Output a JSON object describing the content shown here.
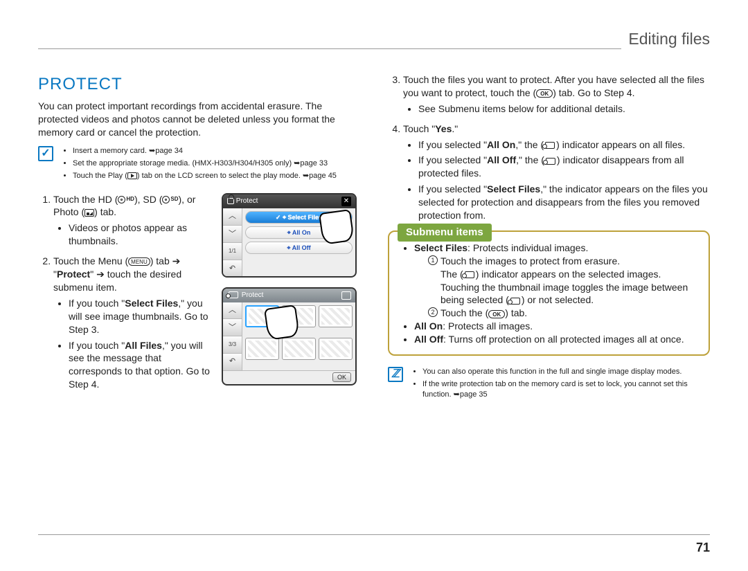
{
  "header": {
    "title": "Editing files"
  },
  "page_number": "71",
  "section": {
    "title": "PROTECT",
    "intro": "You can protect important recordings from accidental erasure. The protected videos and photos cannot be deleted unless you format the memory card or cancel the protection."
  },
  "pre_notes": [
    "Insert a memory card. ➥page 34",
    "Set the appropriate storage media. (HMX-H303/H304/H305 only) ➥page 33",
    "Touch the Play ( ▸ ) tab on the LCD screen to select the play mode. ➥page 45"
  ],
  "steps_left": {
    "s1": {
      "text_a": "Touch the HD (",
      "text_b": "), SD (",
      "text_c": "), or Photo (",
      "text_d": ") tab.",
      "bullet": "Videos or photos appear as thumbnails."
    },
    "s2": {
      "text_a": "Touch the Menu (",
      "text_b": ") tab ",
      "arrow1": "➔",
      "text_c": " \"",
      "protect": "Protect",
      "text_d": "\" ",
      "arrow2": "➔",
      "text_e": " touch the desired submenu item.",
      "b1_a": "If you touch \"",
      "b1_bold": "Select Files",
      "b1_b": ",\" you will see image thumbnails. Go to Step 3.",
      "b2_a": "If you touch \"",
      "b2_bold": "All Files",
      "b2_b": ",\" you will see the message that corresponds to that option. Go to Step 4."
    }
  },
  "steps_right": {
    "s3": {
      "text_a": "Touch the files you want to protect. After you have selected all the files you want to protect, touch the (",
      "ok": "OK",
      "text_b": ") tab. Go to Step 4.",
      "bullet": "See Submenu items below for additional details."
    },
    "s4": {
      "text_a": "Touch \"",
      "yes": "Yes",
      "text_b": ".\"",
      "b1_a": "If you selected \"",
      "b1_bold": "All On",
      "b1_b": ",\" the (",
      "b1_c": ") indicator appears on all files.",
      "b2_a": "If you selected \"",
      "b2_bold": "All Off",
      "b2_b": ",\" the (",
      "b2_c": ") indicator disappears from all protected files.",
      "b3_a": "If you selected \"",
      "b3_bold": "Select Files",
      "b3_b": ",\" the indicator appears on the files you selected for protection and disappears from the files you removed protection from."
    }
  },
  "submenu": {
    "heading": "Submenu items",
    "sf": {
      "label": "Select Files",
      "desc": ": Protects individual images.",
      "n1_a": "Touch the images to protect from erasure.",
      "n1_b": "The (",
      "n1_c": ") indicator appears on the selected images. Touching the thumbnail image toggles the image between being selected (",
      "n1_d": ") or not selected.",
      "n2_a": "Touch the (",
      "n2_ok": "OK",
      "n2_b": ") tab."
    },
    "ao": {
      "label": "All On",
      "desc": ": Protects all images."
    },
    "af": {
      "label": "All Off",
      "desc": ": Turns off protection on all protected images all at once."
    }
  },
  "post_notes": [
    "You can also operate this function in the full and single image display modes.",
    "If the write protection tab on the memory card is set to lock, you cannot set this function. ➥page 35"
  ],
  "lcd1": {
    "title": "Protect",
    "row1": "Select Files",
    "row2": "All On",
    "row3": "All Off",
    "side_page": "1/1"
  },
  "lcd2": {
    "title": "Protect",
    "side_page": "3/3",
    "ok": "OK"
  },
  "labels": {
    "hd": "HD",
    "sd": "SD",
    "menu": "MENU"
  }
}
